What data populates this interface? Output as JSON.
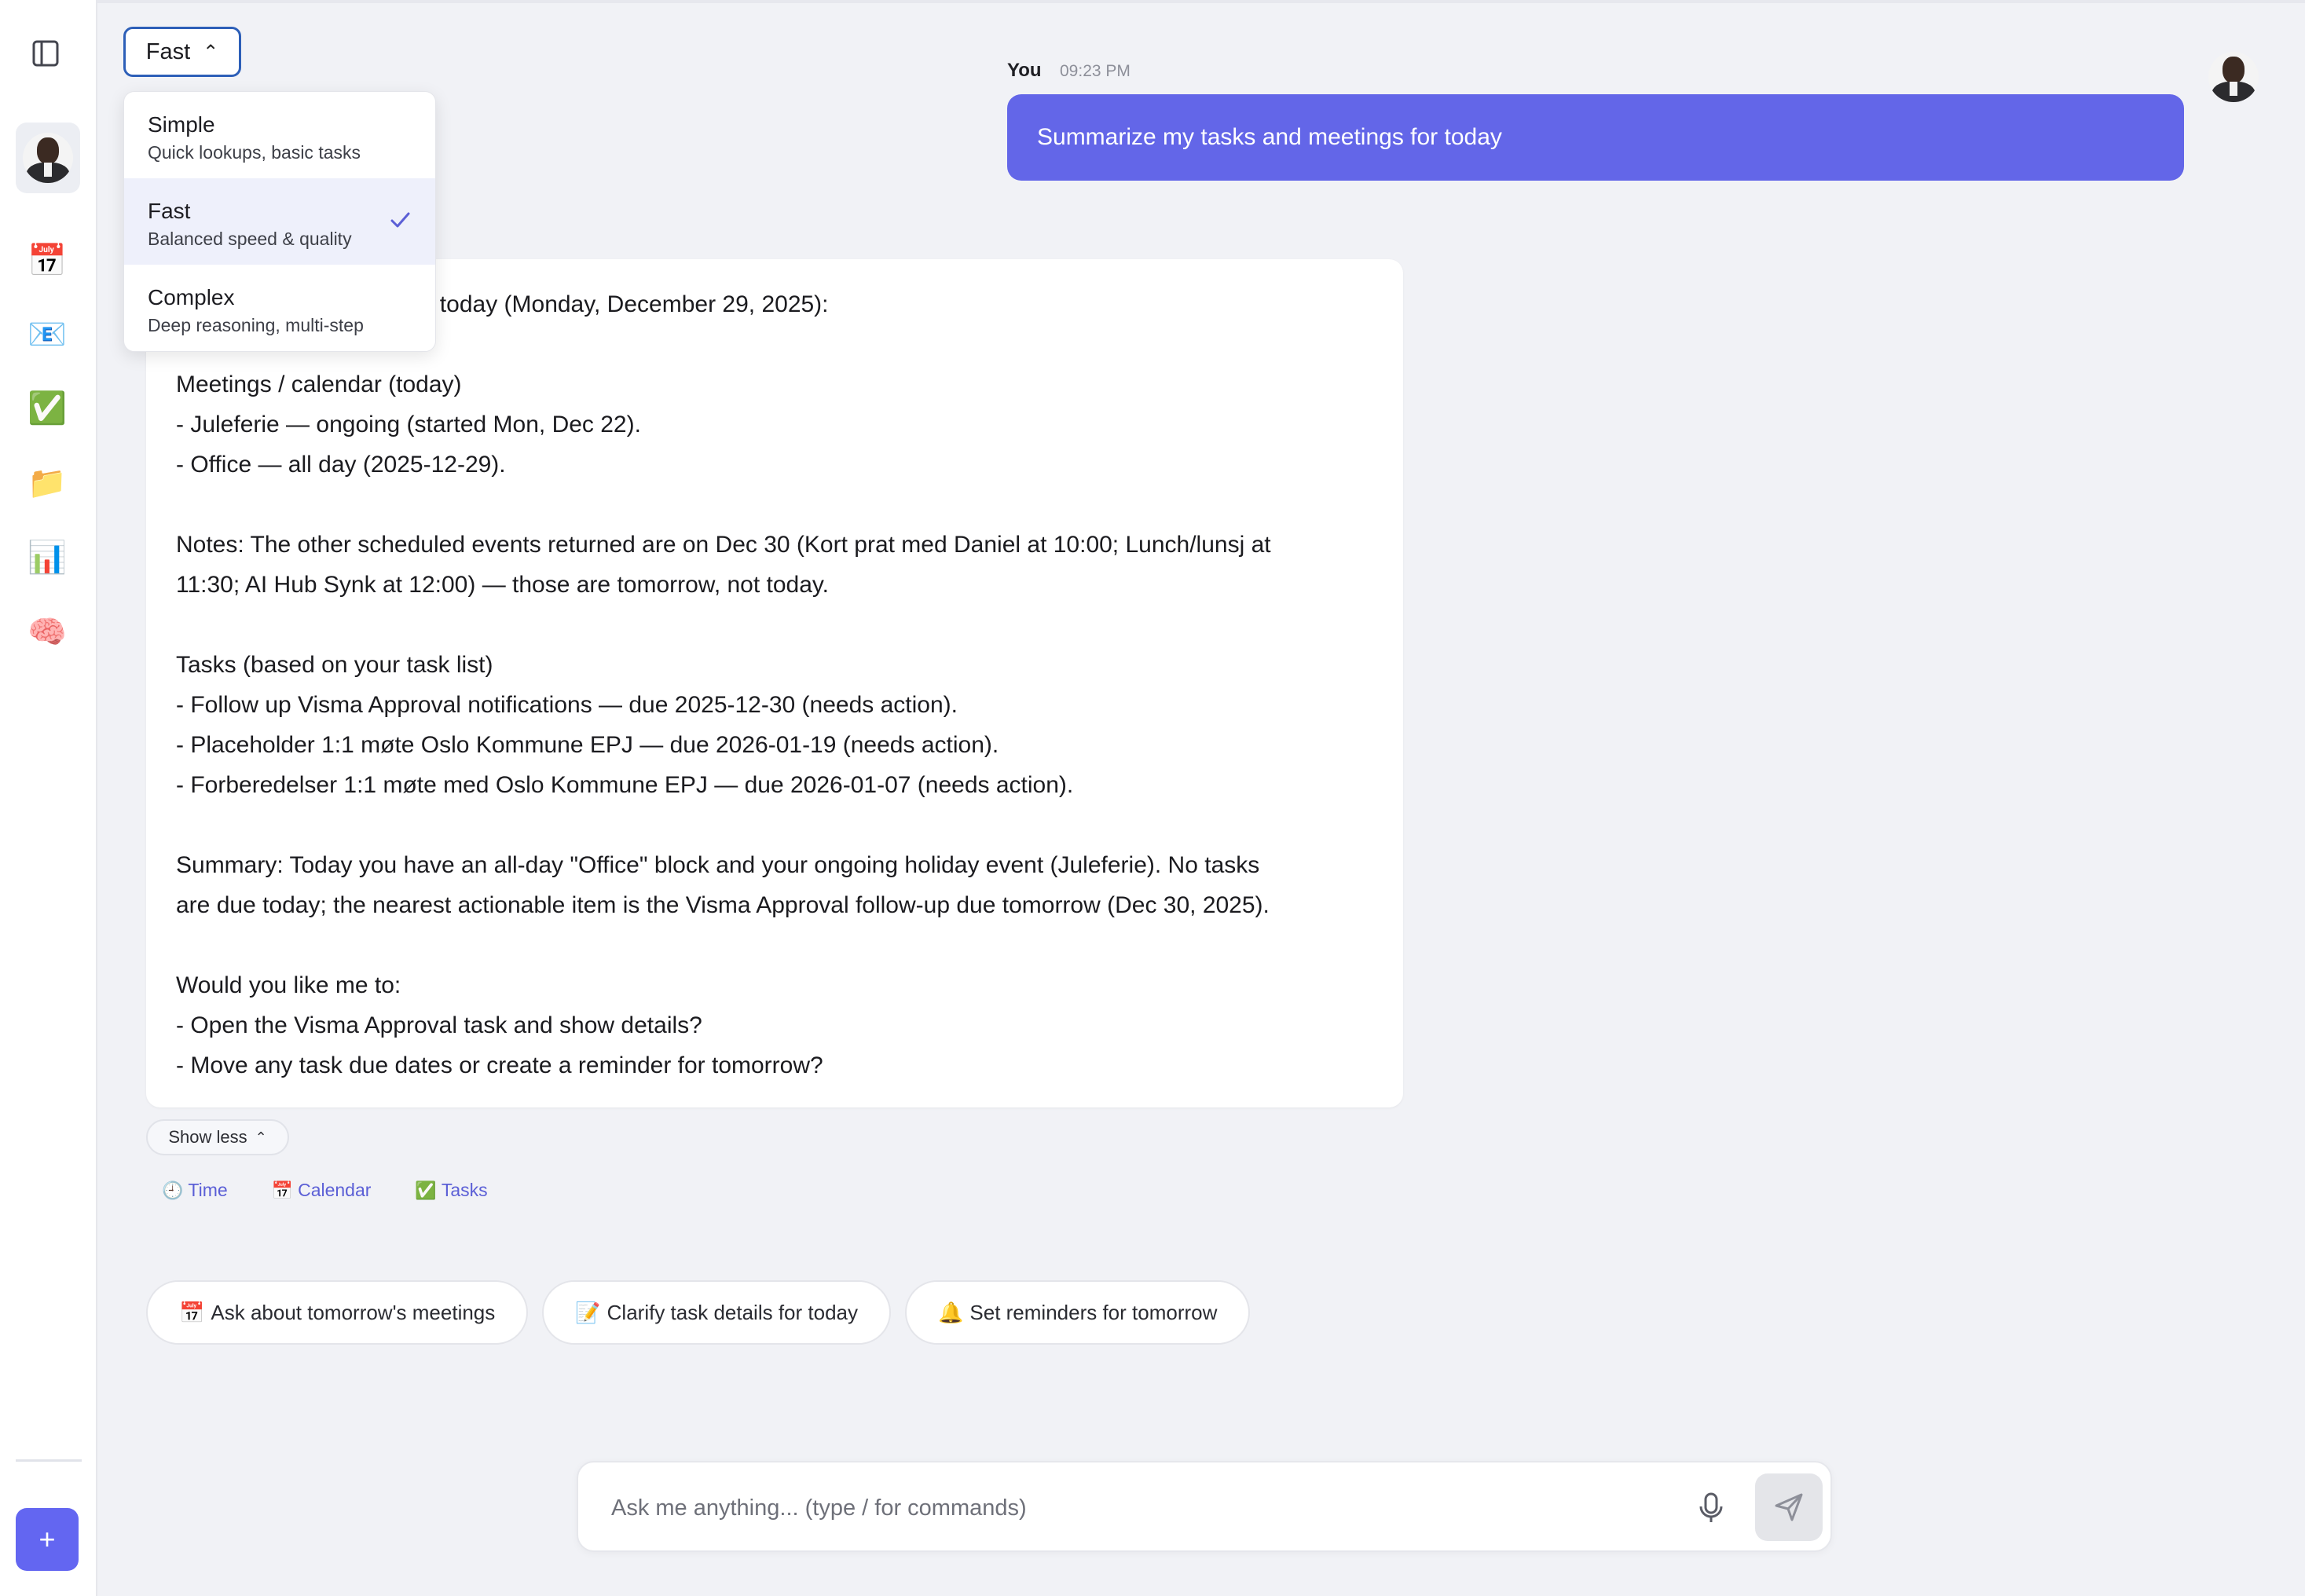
{
  "sidebar": {
    "toggle_icon": "sidebar-toggle-icon",
    "items": [
      {
        "name": "calendar",
        "icon": "📅"
      },
      {
        "name": "mail",
        "icon": "📧"
      },
      {
        "name": "tasks",
        "icon": "✅"
      },
      {
        "name": "files",
        "icon": "📁"
      },
      {
        "name": "analytics",
        "icon": "📊"
      },
      {
        "name": "memory",
        "icon": "🧠"
      }
    ],
    "new_label": "+"
  },
  "model_selector": {
    "current": "Fast",
    "options": [
      {
        "label": "Simple",
        "desc": "Quick lookups, basic tasks",
        "selected": false
      },
      {
        "label": "Fast",
        "desc": "Balanced speed & quality",
        "selected": true
      },
      {
        "label": "Complex",
        "desc": "Deep reasoning, multi-step",
        "selected": false
      }
    ]
  },
  "user_message": {
    "author": "You",
    "time": "09:23 PM",
    "text": "Summarize my tasks and meetings for today"
  },
  "assistant_message": {
    "lines": [
      "Here's your summary for today (Monday, December 29, 2025):",
      "",
      "Meetings / calendar (today)",
      "- Juleferie — ongoing (started Mon, Dec 22).",
      "- Office — all day (2025-12-29).",
      "",
      "Notes: The other scheduled events returned are on Dec 30 (Kort prat med Daniel at 10:00; Lunch/lunsj at",
      "11:30; AI Hub Synk at 12:00) — those are tomorrow, not today.",
      "",
      "Tasks (based on your task list)",
      "- Follow up Visma Approval notifications — due 2025-12-30 (needs action).",
      "- Placeholder 1:1 møte Oslo Kommune EPJ — due 2026-01-19 (needs action).",
      "- Forberedelser 1:1 møte med Oslo Kommune EPJ — due 2026-01-07 (needs action).",
      "",
      "Summary: Today you have an all-day \"Office\" block and your ongoing holiday event (Juleferie). No tasks",
      "are due today; the nearest actionable item is the Visma Approval follow-up due tomorrow (Dec 30, 2025).",
      "",
      "Would you like me to:",
      "- Open the Visma Approval task and show details?",
      "- Move any task due dates or create a reminder for tomorrow?"
    ],
    "show_less_label": "Show less",
    "tools": [
      {
        "icon": "🕘",
        "label": "Time"
      },
      {
        "icon": "📅",
        "label": "Calendar"
      },
      {
        "icon": "✅",
        "label": "Tasks"
      }
    ]
  },
  "suggestions": [
    {
      "icon": "📅",
      "label": "Ask about tomorrow's meetings"
    },
    {
      "icon": "📝",
      "label": "Clarify task details for today"
    },
    {
      "icon": "🔔",
      "label": "Set reminders for tomorrow"
    }
  ],
  "composer": {
    "placeholder": "Ask me anything... (type / for commands)",
    "value": ""
  },
  "colors": {
    "accent": "#6366f1",
    "user_bubble": "#6366e8",
    "tool_link": "#5b5fd6",
    "dropdown_border": "#2d5fb8"
  }
}
